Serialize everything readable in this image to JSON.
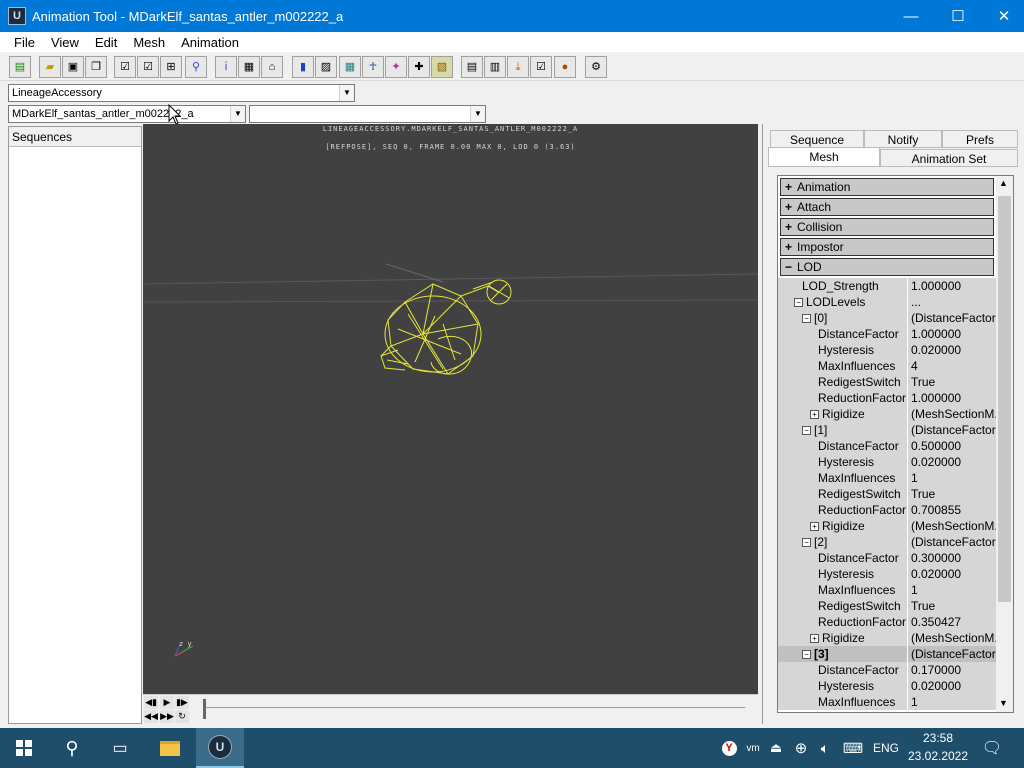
{
  "window": {
    "title": "Animation Tool - MDarkElf_santas_antler_m002222_a",
    "app_icon": "unreal-logo-icon",
    "minimize": "—",
    "maximize": "☐",
    "close": "✕"
  },
  "menu": [
    "File",
    "View",
    "Edit",
    "Mesh",
    "Animation"
  ],
  "combos": {
    "package": "LineageAccessory",
    "mesh": "MDarkElf_santas_antler_m002222_a",
    "anim_set": ""
  },
  "sequences": {
    "header": "Sequences"
  },
  "viewport": {
    "line1": "LINEAGEACCESSORY.MDARKELF_SANTAS_ANTLER_M002222_A",
    "line2": "[REFPOSE], SEQ 0,  FRAME  0.00 MAX 0,  LOD 0 (3.63)",
    "axis_label": "z y",
    "bg_color": "#414141",
    "wire_color": "#e5e53a"
  },
  "tabs": {
    "row1": [
      "Sequence",
      "Notify",
      "Prefs"
    ],
    "row2": [
      "Mesh",
      "Animation Set"
    ],
    "active": "Mesh"
  },
  "categories": [
    {
      "sign": "+",
      "label": "Animation"
    },
    {
      "sign": "+",
      "label": "Attach"
    },
    {
      "sign": "+",
      "label": "Collision"
    },
    {
      "sign": "+",
      "label": "Impostor"
    },
    {
      "sign": "−",
      "label": "LOD"
    }
  ],
  "lod_props": [
    {
      "name": "LOD_Strength",
      "value": "1.000000"
    },
    {
      "name": "LODLevels",
      "value": "..."
    },
    {
      "name": "[0]",
      "value": "(DistanceFactor..."
    },
    {
      "name": "DistanceFactor",
      "value": "1.000000"
    },
    {
      "name": "Hysteresis",
      "value": "0.020000"
    },
    {
      "name": "MaxInfluences",
      "value": "4"
    },
    {
      "name": "RedigestSwitch",
      "value": "True"
    },
    {
      "name": "ReductionFactor",
      "value": "1.000000"
    },
    {
      "name": "Rigidize",
      "value": "(MeshSectionM..."
    },
    {
      "name": "[1]",
      "value": "(DistanceFactor..."
    },
    {
      "name": "DistanceFactor",
      "value": "0.500000"
    },
    {
      "name": "Hysteresis",
      "value": "0.020000"
    },
    {
      "name": "MaxInfluences",
      "value": "1"
    },
    {
      "name": "RedigestSwitch",
      "value": "True"
    },
    {
      "name": "ReductionFactor",
      "value": "0.700855"
    },
    {
      "name": "Rigidize",
      "value": "(MeshSectionM..."
    },
    {
      "name": "[2]",
      "value": "(DistanceFactor..."
    },
    {
      "name": "DistanceFactor",
      "value": "0.300000"
    },
    {
      "name": "Hysteresis",
      "value": "0.020000"
    },
    {
      "name": "MaxInfluences",
      "value": "1"
    },
    {
      "name": "RedigestSwitch",
      "value": "True"
    },
    {
      "name": "ReductionFactor",
      "value": "0.350427"
    },
    {
      "name": "Rigidize",
      "value": "(MeshSectionM..."
    },
    {
      "name": "[3]",
      "value": "(DistanceFactor..."
    },
    {
      "name": "DistanceFactor",
      "value": "0.170000"
    },
    {
      "name": "Hysteresis",
      "value": "0.020000"
    },
    {
      "name": "MaxInfluences",
      "value": "1"
    }
  ],
  "taskbar": {
    "lang": "ENG",
    "time": "23:58",
    "date": "23.02.2022"
  }
}
